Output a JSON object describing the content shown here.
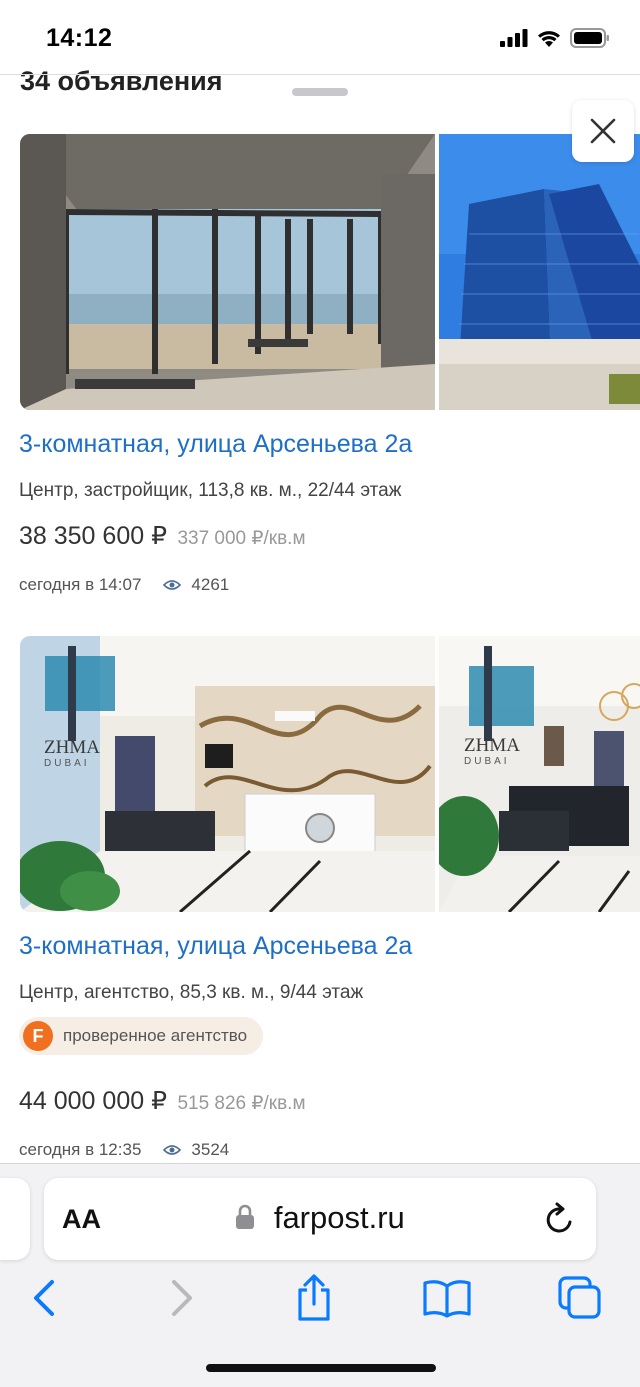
{
  "status_bar": {
    "time": "14:12"
  },
  "sheet": {
    "title": "34 объявления"
  },
  "listings": [
    {
      "title": "3-комнатная, улица Арсеньева 2а",
      "subtitle": "Центр, застройщик, 113,8 кв. м., 22/44 этаж",
      "price": "38 350 600 ₽",
      "price_per_m2": "337 000 ₽/кв.м",
      "date": "сегодня в 14:07",
      "views": "4261"
    },
    {
      "title": "3-комнатная, улица Арсеньева 2а",
      "subtitle": "Центр, агентство, 85,3 кв. м., 9/44 этаж",
      "badge_icon_letter": "F",
      "badge": "проверенное агентство",
      "watermark_top": "ZHMA",
      "watermark_bottom": "DUBAI",
      "price": "44 000 000 ₽",
      "price_per_m2": "515 826 ₽/кв.м",
      "date": "сегодня в 12:35",
      "views": "3524"
    }
  ],
  "browser": {
    "text_size_label": "AA",
    "domain": "farpost.ru"
  },
  "colors": {
    "link": "#1f6fc5",
    "ios_blue": "#0a7aff",
    "badge_orange": "#f07020"
  }
}
